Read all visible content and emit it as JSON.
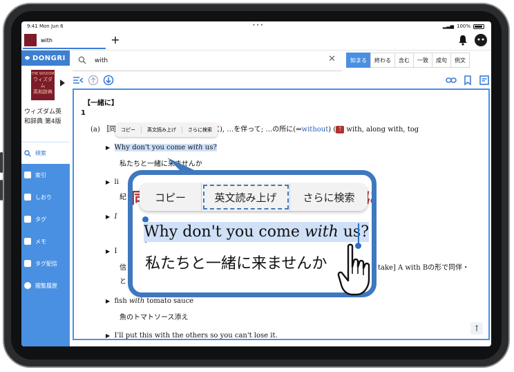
{
  "status": {
    "time": "9:41",
    "date": "Mon Jun 6",
    "battery": "100%"
  },
  "tab": {
    "label": "with"
  },
  "sidebar": {
    "logo": "DONGRI",
    "book_title_line1": "ウィズダム英",
    "book_title_line2": "和辞典 第4版",
    "cover_line1": "THE WISDOM",
    "cover_line2": "ウィズダム",
    "cover_line3": "英和辞典",
    "items": [
      {
        "label": "検索"
      },
      {
        "label": "索引"
      },
      {
        "label": "しおり"
      },
      {
        "label": "タグ"
      },
      {
        "label": "メモ"
      },
      {
        "label": "タグ配信"
      },
      {
        "label": "閲覧履歴"
      }
    ]
  },
  "search": {
    "query": "with"
  },
  "modes": [
    "知まる",
    "終わる",
    "含む",
    "一致",
    "成句",
    "例文"
  ],
  "entry": {
    "heading": "【一緒に】",
    "sense_num": "1",
    "sense_a_prefix": "(a) 〚同",
    "sense_a_mid": "に",
    "sense_a_text": "), …を伴って; …の所に(⇔",
    "sense_a_link": "without",
    "sense_a_end": ") (",
    "sense_a_note": "with, along with, tog",
    "ex1_en_pre": "Why don't you come ",
    "ex1_en_it": "with",
    "ex1_en_post": " us?",
    "ex1_ja": "私たちと一緒に来ませんか",
    "ex2_en": "li",
    "ex2_ja": "紀",
    "ex3_en": "I",
    "ex4_en": "I",
    "ex4_ja1": "信",
    "ex4_ja2": "と",
    "ex4_side": "take] A with Bの形で同伴・",
    "ex5_en_pre": "fish ",
    "ex5_en_it": "with",
    "ex5_en_post": " tomato sauce",
    "ex5_ja": "魚のトマトソース添え",
    "ex6_en": "I'll put this with the others so you can't lose it."
  },
  "menu": {
    "copy": "コピー",
    "read": "英文読み上げ",
    "search_more": "さらに検索"
  },
  "callout": {
    "peek_left": "同",
    "peek_right": "に",
    "line1_pre": "Why don't you come ",
    "line1_it": "with",
    "line1_post": " us?",
    "line2": "私たちと一緒に来ませんか"
  },
  "colors": {
    "accent": "#4a90e2",
    "callout_border": "#3f78bf",
    "headword": "#b03030",
    "selection": "#cfe0f7"
  }
}
